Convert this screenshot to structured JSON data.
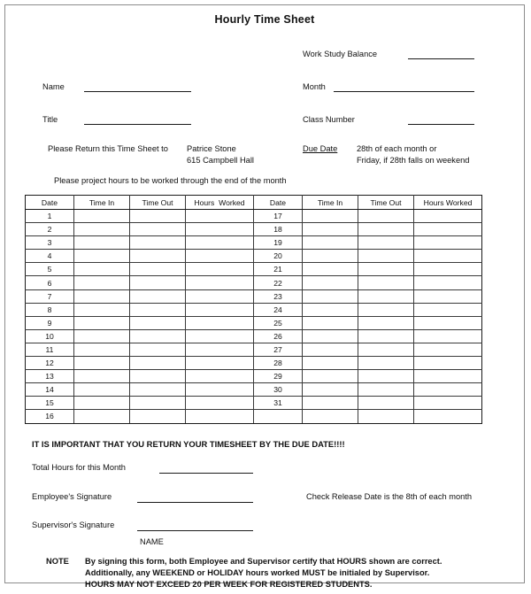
{
  "document": {
    "title": "Hourly Time Sheet"
  },
  "fields": {
    "name_label": "Name",
    "title_label": "Title",
    "work_study_balance_label": "Work Study Balance",
    "month_label": "Month",
    "class_number_label": "Class Number",
    "name_value": "",
    "title_value": "",
    "work_study_balance_value": "",
    "month_value": "",
    "class_number_value": ""
  },
  "return_info": {
    "instruction": "Please Return this Time Sheet to",
    "recipient_name": "Patrice Stone",
    "recipient_address": "615 Campbell Hall",
    "project_note": "Please project hours to be worked through the end of the month"
  },
  "due_date": {
    "label": "Due Date",
    "line1": "28th of each month or",
    "line2": "Friday, if 28th falls on weekend"
  },
  "table": {
    "headers_left": [
      "Date",
      "Time In",
      "Time Out",
      "Hours  Worked"
    ],
    "headers_right": [
      "Date",
      "Time In",
      "Time Out",
      "Hours Worked"
    ],
    "rows": [
      {
        "left_date": "1",
        "left_time_in": "",
        "left_time_out": "",
        "left_hours": "",
        "right_date": "17",
        "right_time_in": "",
        "right_time_out": "",
        "right_hours": ""
      },
      {
        "left_date": "2",
        "left_time_in": "",
        "left_time_out": "",
        "left_hours": "",
        "right_date": "18",
        "right_time_in": "",
        "right_time_out": "",
        "right_hours": ""
      },
      {
        "left_date": "3",
        "left_time_in": "",
        "left_time_out": "",
        "left_hours": "",
        "right_date": "19",
        "right_time_in": "",
        "right_time_out": "",
        "right_hours": ""
      },
      {
        "left_date": "4",
        "left_time_in": "",
        "left_time_out": "",
        "left_hours": "",
        "right_date": "20",
        "right_time_in": "",
        "right_time_out": "",
        "right_hours": ""
      },
      {
        "left_date": "5",
        "left_time_in": "",
        "left_time_out": "",
        "left_hours": "",
        "right_date": "21",
        "right_time_in": "",
        "right_time_out": "",
        "right_hours": ""
      },
      {
        "left_date": "6",
        "left_time_in": "",
        "left_time_out": "",
        "left_hours": "",
        "right_date": "22",
        "right_time_in": "",
        "right_time_out": "",
        "right_hours": ""
      },
      {
        "left_date": "7",
        "left_time_in": "",
        "left_time_out": "",
        "left_hours": "",
        "right_date": "23",
        "right_time_in": "",
        "right_time_out": "",
        "right_hours": ""
      },
      {
        "left_date": "8",
        "left_time_in": "",
        "left_time_out": "",
        "left_hours": "",
        "right_date": "24",
        "right_time_in": "",
        "right_time_out": "",
        "right_hours": ""
      },
      {
        "left_date": "9",
        "left_time_in": "",
        "left_time_out": "",
        "left_hours": "",
        "right_date": "25",
        "right_time_in": "",
        "right_time_out": "",
        "right_hours": ""
      },
      {
        "left_date": "10",
        "left_time_in": "",
        "left_time_out": "",
        "left_hours": "",
        "right_date": "26",
        "right_time_in": "",
        "right_time_out": "",
        "right_hours": ""
      },
      {
        "left_date": "11",
        "left_time_in": "",
        "left_time_out": "",
        "left_hours": "",
        "right_date": "27",
        "right_time_in": "",
        "right_time_out": "",
        "right_hours": ""
      },
      {
        "left_date": "12",
        "left_time_in": "",
        "left_time_out": "",
        "left_hours": "",
        "right_date": "28",
        "right_time_in": "",
        "right_time_out": "",
        "right_hours": ""
      },
      {
        "left_date": "13",
        "left_time_in": "",
        "left_time_out": "",
        "left_hours": "",
        "right_date": "29",
        "right_time_in": "",
        "right_time_out": "",
        "right_hours": ""
      },
      {
        "left_date": "14",
        "left_time_in": "",
        "left_time_out": "",
        "left_hours": "",
        "right_date": "30",
        "right_time_in": "",
        "right_time_out": "",
        "right_hours": ""
      },
      {
        "left_date": "15",
        "left_time_in": "",
        "left_time_out": "",
        "left_hours": "",
        "right_date": "31",
        "right_time_in": "",
        "right_time_out": "",
        "right_hours": ""
      },
      {
        "left_date": "16",
        "left_time_in": "",
        "left_time_out": "",
        "left_hours": "",
        "right_date": "",
        "right_time_in": "",
        "right_time_out": "",
        "right_hours": ""
      }
    ]
  },
  "footer": {
    "important_notice": "IT IS IMPORTANT THAT YOU RETURN YOUR TIMESHEET BY THE DUE DATE!!!!",
    "total_hours_label": "Total Hours for this Month",
    "total_hours_value": "",
    "employee_signature_label": "Employee's Signature",
    "employee_signature_value": "",
    "check_release_text": "Check Release Date is the 8th of each month",
    "supervisor_signature_label": "Supervisor's Signature",
    "supervisor_signature_value": "",
    "name_caption": "NAME",
    "note_label": "NOTE",
    "note_line1": "By signing this form, both Employee and Supervisor certify that HOURS shown are correct.",
    "note_line2": "Additionally, any WEEKEND or HOLIDAY hours worked MUST be initialed by Supervisor.",
    "note_line3": "HOURS MAY NOT EXCEED 20 PER WEEK FOR REGISTERED STUDENTS."
  },
  "colors": {
    "ink": "#111111",
    "rule": "#1a1a1a",
    "page_border": "#8c8c8c"
  }
}
